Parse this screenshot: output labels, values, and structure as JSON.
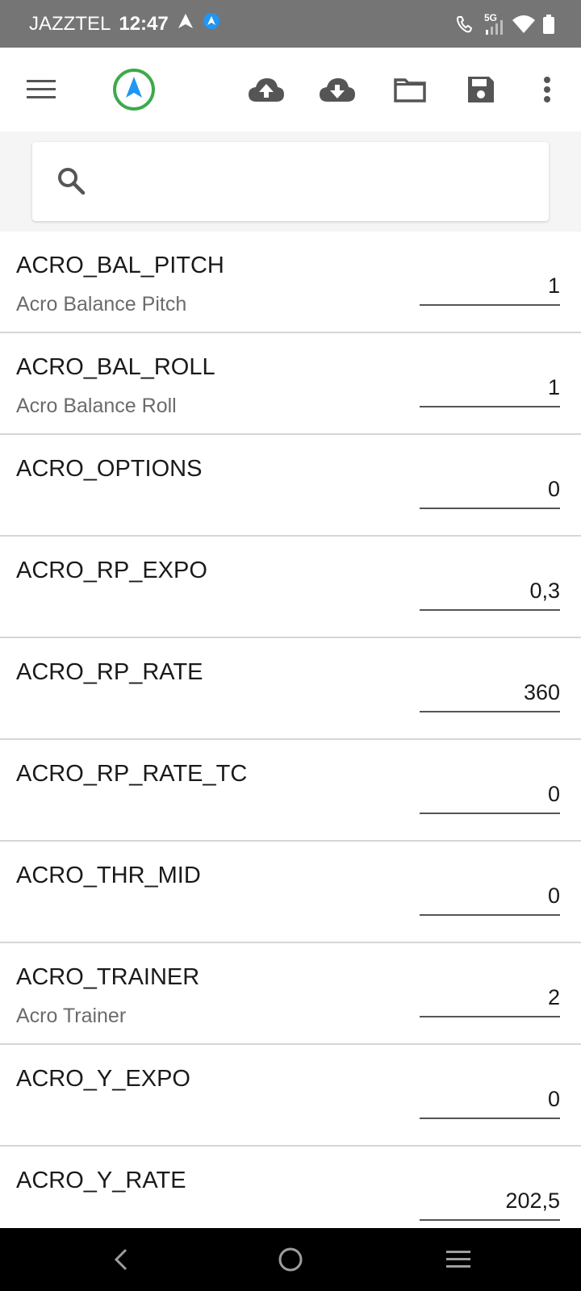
{
  "status_bar": {
    "carrier": "JAZZTEL",
    "time": "12:47",
    "network_label": "5G"
  },
  "toolbar": {
    "menu_icon": "hamburger-menu-icon",
    "logo_icon": "navigation-arrow-logo",
    "upload_icon": "cloud-upload-icon",
    "download_icon": "cloud-download-icon",
    "folder_icon": "folder-icon",
    "save_icon": "save-disk-icon",
    "more_icon": "more-vertical-icon"
  },
  "search": {
    "placeholder": "",
    "value": ""
  },
  "params": [
    {
      "name": "ACRO_BAL_PITCH",
      "desc": "Acro Balance Pitch",
      "value": "1"
    },
    {
      "name": "ACRO_BAL_ROLL",
      "desc": "Acro Balance Roll",
      "value": "1"
    },
    {
      "name": "ACRO_OPTIONS",
      "desc": "",
      "value": "0"
    },
    {
      "name": "ACRO_RP_EXPO",
      "desc": "",
      "value": "0,3"
    },
    {
      "name": "ACRO_RP_RATE",
      "desc": "",
      "value": "360"
    },
    {
      "name": "ACRO_RP_RATE_TC",
      "desc": "",
      "value": "0"
    },
    {
      "name": "ACRO_THR_MID",
      "desc": "",
      "value": "0"
    },
    {
      "name": "ACRO_TRAINER",
      "desc": "Acro Trainer",
      "value": "2"
    },
    {
      "name": "ACRO_Y_EXPO",
      "desc": "",
      "value": "0"
    },
    {
      "name": "ACRO_Y_RATE",
      "desc": "",
      "value": "202,5"
    }
  ],
  "colors": {
    "status_bar": "#757575",
    "logo_ring": "#3daa4a",
    "logo_arrow": "#2196f3",
    "icon": "#555555"
  }
}
